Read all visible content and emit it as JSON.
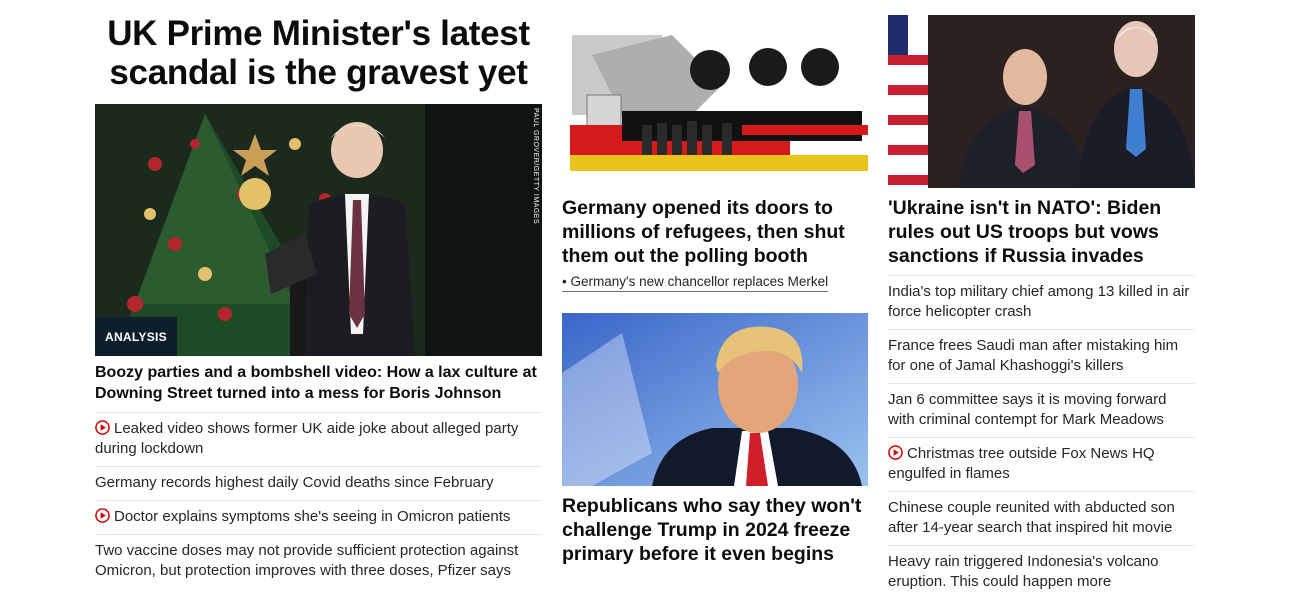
{
  "left": {
    "headline": "UK Prime Minister's latest scandal is the gravest yet",
    "image_credit": "PAUL GROVER/GETTY IMAGES",
    "badge": "ANALYSIS",
    "lead_title": "Boozy parties and a bombshell video: How a lax culture at Downing Street turned into a mess for Boris Johnson",
    "links": [
      {
        "text": "Leaked video shows former UK aide joke about alleged party during lockdown",
        "video": true
      },
      {
        "text": "Germany records highest daily Covid deaths since February",
        "video": false
      },
      {
        "text": "Doctor explains symptoms she's seeing in Omicron patients",
        "video": true
      },
      {
        "text": "Two vaccine doses may not provide sufficient protection against Omicron, but protection improves with three doses, Pfizer says",
        "video": false
      }
    ]
  },
  "middle": {
    "card1_title": "Germany opened its doors to millions of refugees, then shut them out the polling booth",
    "card1_sublink": "• Germany's new chancellor replaces Merkel",
    "card2_title": "Republicans who say they won't challenge Trump in 2024 freeze primary before it even begins"
  },
  "right": {
    "card_title": "'Ukraine isn't in NATO': Biden rules out US troops but vows sanctions if Russia invades",
    "links": [
      {
        "text": "India's top military chief among 13 killed in air force helicopter crash",
        "video": false
      },
      {
        "text": "France frees Saudi man after mistaking him for one of Jamal Khashoggi's killers",
        "video": false
      },
      {
        "text": "Jan 6 committee says it is moving forward with criminal contempt for Mark Meadows",
        "video": false
      },
      {
        "text": "Christmas tree outside Fox News HQ engulfed in flames",
        "video": true
      },
      {
        "text": "Chinese couple reunited with abducted son after 14-year search that inspired hit movie",
        "video": false
      },
      {
        "text": "Heavy rain triggered Indonesia's volcano eruption. This could happen more",
        "video": false
      }
    ]
  },
  "colors": {
    "play_red": "#cc0000",
    "badge_bg": "#0c1f2c"
  }
}
